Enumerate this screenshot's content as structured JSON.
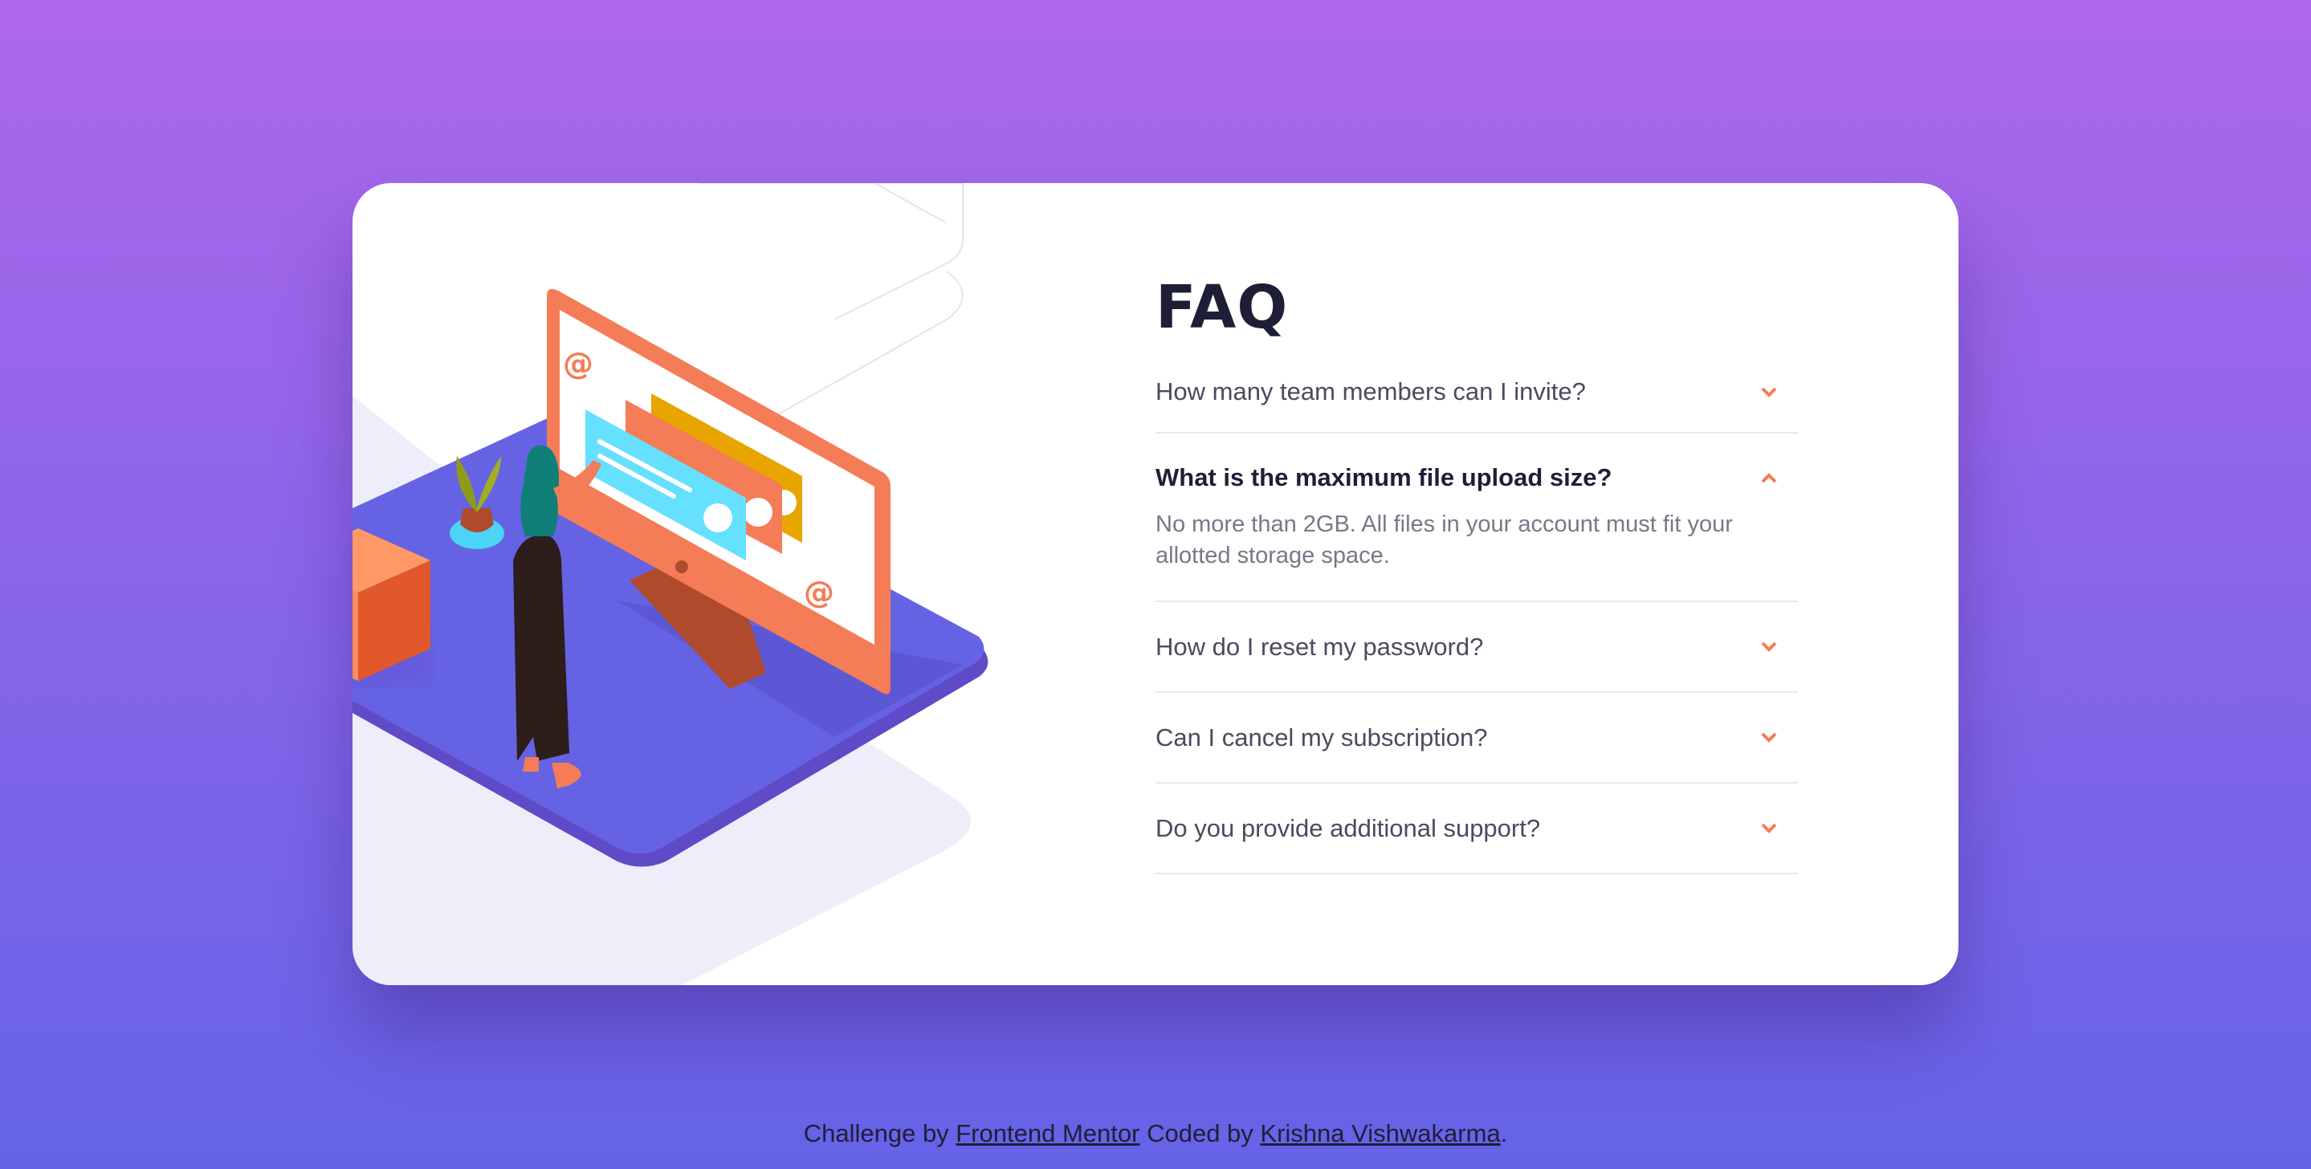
{
  "faq": {
    "title": "FAQ",
    "items": [
      {
        "question": "How many team members can I invite?",
        "open": false
      },
      {
        "question": "What is the maximum file upload size?",
        "open": true,
        "answer": "No more than 2GB. All files in your account must fit your allotted storage space."
      },
      {
        "question": "How do I reset my password?",
        "open": false
      },
      {
        "question": "Can I cancel my subscription?",
        "open": false
      },
      {
        "question": "Do you provide additional support?",
        "open": false
      }
    ]
  },
  "footer": {
    "prefix": "Challenge by ",
    "mentor_link": "Frontend Mentor",
    "middle": " Coded by ",
    "author_link": "Krishna Vishwakarma",
    "suffix": "."
  },
  "colors": {
    "accent": "#f47c57",
    "bg_top": "#ae67ea",
    "bg_bottom": "#6463e7",
    "heading": "#1e1f36",
    "text": "#4a4b5e",
    "answer": "#787887"
  },
  "icons": {
    "chevron_down": "chevron-down-icon",
    "chevron_up": "chevron-up-icon"
  }
}
